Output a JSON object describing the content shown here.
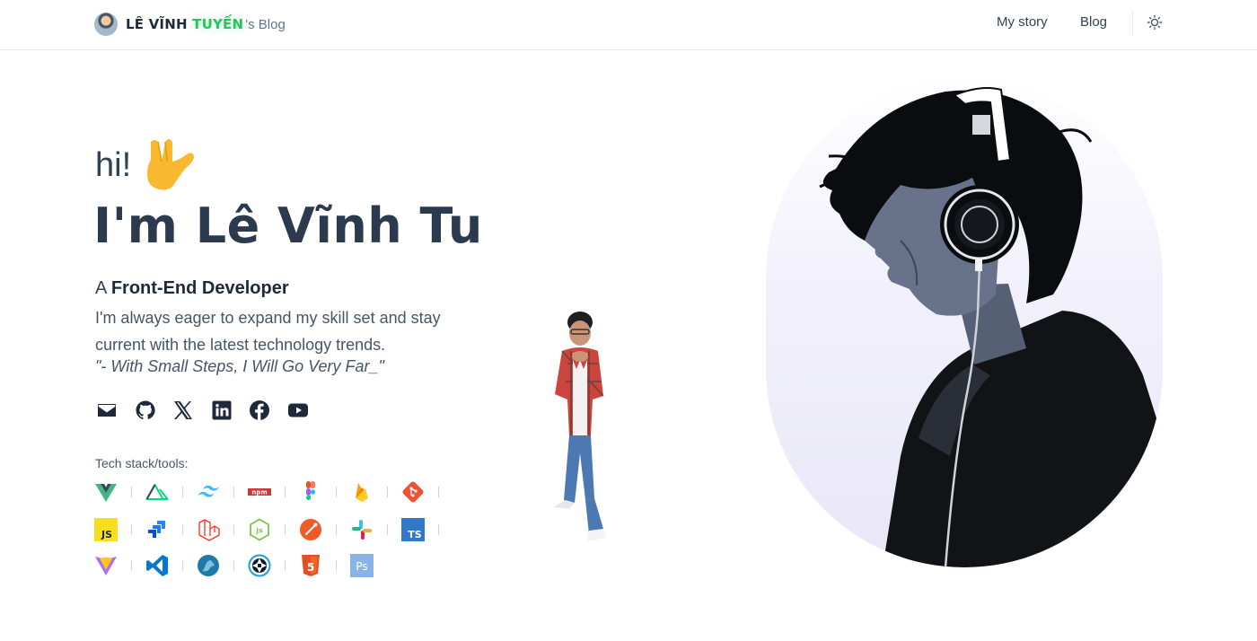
{
  "header": {
    "brand_name": "LÊ VĨNH",
    "brand_highlight": "TUYẾN",
    "brand_suffix": "'s Blog",
    "nav": {
      "my_story": "My story",
      "blog": "Blog"
    },
    "theme_icon": "sun-icon"
  },
  "hero": {
    "greeting": "hi!",
    "greeting_emoji": "call-me-hand",
    "headline": "I'm Lê Vĩnh Tu",
    "role_prefix": "A",
    "role": "Front-End Developer",
    "bio": "I'm always eager to expand my skill set and stay current with the latest technology trends.",
    "quote": "\"- With Small Steps, I Will Go Very Far_\""
  },
  "socials": [
    "mail-icon",
    "github-icon",
    "x-icon",
    "linkedin-icon",
    "facebook-icon",
    "youtube-icon"
  ],
  "tech": {
    "label": "Tech stack/tools:",
    "rows": [
      [
        "vue-icon",
        "nuxt-icon",
        "tailwind-icon",
        "npm-icon",
        "figma-icon",
        "firebase-icon",
        "git-icon"
      ],
      [
        "javascript-icon",
        "jira-icon",
        "laravel-icon",
        "nodejs-icon",
        "postman-icon",
        "slack-icon",
        "typescript-icon"
      ],
      [
        "vite-icon",
        "vscode-icon",
        "mariadb-icon",
        "aperture-icon",
        "html5-icon",
        "photoshop-icon"
      ]
    ],
    "npm_text": "npm",
    "js_text": "JS",
    "ts_text": "TS",
    "ps_text": "Ps",
    "html_text": "5"
  },
  "colors": {
    "text_dark": "#2b3a4e",
    "brand_green": "#22c55e",
    "muted": "#475569"
  }
}
